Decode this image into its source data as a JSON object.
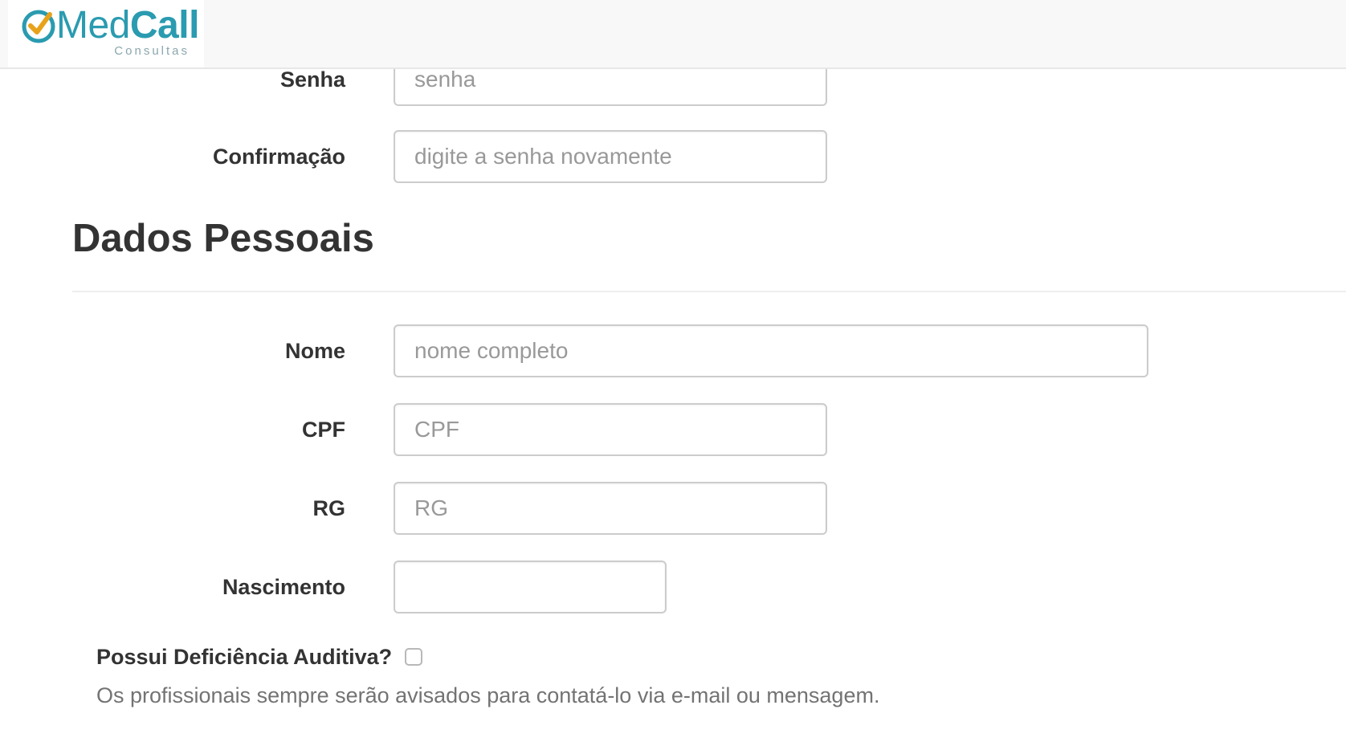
{
  "brand": {
    "name_part1": "Med",
    "name_part2": "Call",
    "tagline": "Consultas",
    "icon": "check-circle-icon",
    "color": "#2a9bb0",
    "check_color": "#e8a21a"
  },
  "credentials": {
    "password": {
      "label": "Senha",
      "placeholder": "senha",
      "value": ""
    },
    "confirmation": {
      "label": "Confirmação",
      "placeholder": "digite a senha novamente",
      "value": ""
    }
  },
  "personal": {
    "title": "Dados Pessoais",
    "name": {
      "label": "Nome",
      "placeholder": "nome completo",
      "value": ""
    },
    "cpf": {
      "label": "CPF",
      "placeholder": "CPF",
      "value": ""
    },
    "rg": {
      "label": "RG",
      "placeholder": "RG",
      "value": ""
    },
    "birth": {
      "label": "Nascimento",
      "placeholder": "",
      "value": ""
    },
    "hearing_impairment": {
      "label": "Possui Deficiência Auditiva?",
      "checked": false,
      "help": "Os profissionais sempre serão avisados para contatá-lo via e-mail ou mensagem."
    }
  }
}
